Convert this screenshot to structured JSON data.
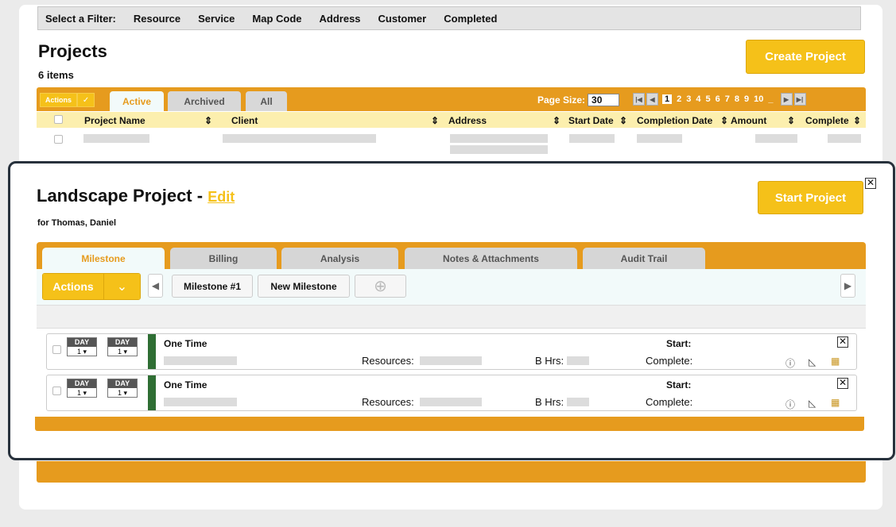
{
  "filters": {
    "label": "Select a Filter:",
    "items": [
      "Resource",
      "Service",
      "Map Code",
      "Address",
      "Customer",
      "Completed"
    ]
  },
  "projects": {
    "title": "Projects",
    "count": "6 items",
    "create_label": "Create Project",
    "actions_label": "Actions",
    "tabs": [
      "Active",
      "Archived",
      "All"
    ],
    "page_size_label": "Page Size:",
    "page_size": "30",
    "pages": [
      "1",
      "2",
      "3",
      "4",
      "5",
      "6",
      "7",
      "8",
      "9",
      "10",
      "_"
    ],
    "columns": [
      "Project Name",
      "Client",
      "Address",
      "Start Date",
      "Completion Date",
      "Amount",
      "Complete"
    ]
  },
  "modal": {
    "title": "Landscape Project -",
    "edit_label": "Edit",
    "subtitle": "for Thomas, Daniel",
    "start_label": "Start Project",
    "tabs": [
      "Milestone",
      "Billing",
      "Analysis",
      "Notes & Attachments",
      "Audit Trail"
    ],
    "actions_label": "Actions",
    "milestone_1": "Milestone #1",
    "new_milestone": "New Milestone",
    "rows": [
      {
        "day1_head": "DAY",
        "day1_val": "1",
        "day2_head": "DAY",
        "day2_val": "1",
        "title": "One Time",
        "resources_label": "Resources:",
        "bhrs_label": "B Hrs:",
        "start_label": "Start:",
        "complete_label": "Complete:"
      },
      {
        "day1_head": "DAY",
        "day1_val": "1",
        "day2_head": "DAY",
        "day2_val": "1",
        "title": "One Time",
        "resources_label": "Resources:",
        "bhrs_label": "B Hrs:",
        "start_label": "Start:",
        "complete_label": "Complete:"
      }
    ]
  },
  "icons": {
    "close": "close-icon",
    "chevron": "chevron-down-icon",
    "add": "plus-circle-icon",
    "info": "info-icon",
    "note": "note-icon",
    "calendar": "calendar-icon"
  },
  "colors": {
    "orange": "#e69b1e",
    "yellow": "#f5c119",
    "green": "#2f6e34",
    "modal_border": "#27313c"
  }
}
